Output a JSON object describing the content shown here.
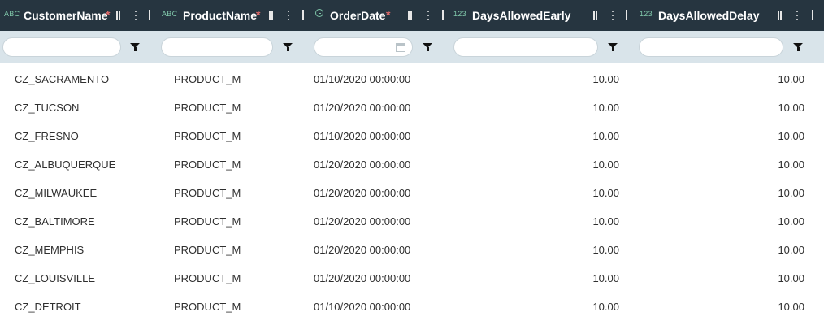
{
  "columns": [
    {
      "type": "ABC",
      "title": "CustomerName",
      "required": "*"
    },
    {
      "type": "ABC",
      "title": "ProductName",
      "required": "*"
    },
    {
      "type": "clock",
      "title": "OrderDate",
      "required": "*"
    },
    {
      "type": "123",
      "title": "DaysAllowedEarly",
      "required": ""
    },
    {
      "type": "123",
      "title": "DaysAllowedDelay",
      "required": ""
    }
  ],
  "filters": {
    "customer": "",
    "product": "",
    "date": "",
    "early": "",
    "delay": ""
  },
  "rows": [
    {
      "customer": "CZ_SACRAMENTO",
      "product": "PRODUCT_M",
      "date": "01/10/2020 00:00:00",
      "early": "10.00",
      "delay": "10.00"
    },
    {
      "customer": "CZ_TUCSON",
      "product": "PRODUCT_M",
      "date": "01/20/2020 00:00:00",
      "early": "10.00",
      "delay": "10.00"
    },
    {
      "customer": "CZ_FRESNO",
      "product": "PRODUCT_M",
      "date": "01/10/2020 00:00:00",
      "early": "10.00",
      "delay": "10.00"
    },
    {
      "customer": "CZ_ALBUQUERQUE",
      "product": "PRODUCT_M",
      "date": "01/20/2020 00:00:00",
      "early": "10.00",
      "delay": "10.00"
    },
    {
      "customer": "CZ_MILWAUKEE",
      "product": "PRODUCT_M",
      "date": "01/20/2020 00:00:00",
      "early": "10.00",
      "delay": "10.00"
    },
    {
      "customer": "CZ_BALTIMORE",
      "product": "PRODUCT_M",
      "date": "01/20/2020 00:00:00",
      "early": "10.00",
      "delay": "10.00"
    },
    {
      "customer": "CZ_MEMPHIS",
      "product": "PRODUCT_M",
      "date": "01/20/2020 00:00:00",
      "early": "10.00",
      "delay": "10.00"
    },
    {
      "customer": "CZ_LOUISVILLE",
      "product": "PRODUCT_M",
      "date": "01/20/2020 00:00:00",
      "early": "10.00",
      "delay": "10.00"
    },
    {
      "customer": "CZ_DETROIT",
      "product": "PRODUCT_M",
      "date": "01/10/2020 00:00:00",
      "early": "10.00",
      "delay": "10.00"
    }
  ],
  "icons": {
    "type_text": "ABC",
    "type_number": "123",
    "type_date": "clock-icon",
    "filter": "funnel-icon",
    "calendar": "calendar-icon"
  },
  "colors": {
    "header_bg": "#263540",
    "filter_bg": "#d9e4ea",
    "type_icon": "#7fc6a9",
    "required": "#e06a6a"
  }
}
